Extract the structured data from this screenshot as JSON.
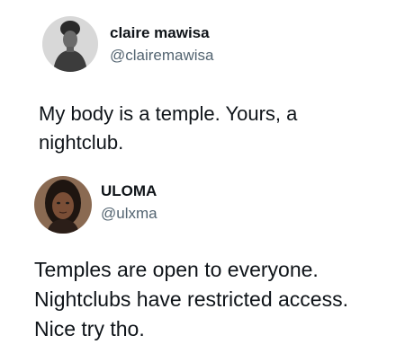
{
  "tweets": [
    {
      "display_name": "claire mawisa",
      "handle": "@clairemawisa",
      "body_lines": [
        "My body is a temple. Yours, a",
        "nightclub."
      ]
    },
    {
      "display_name": "ULOMA",
      "handle": "@ulxma",
      "body_lines": [
        "Temples are open to everyone.",
        "Nightclubs have restricted access.",
        "Nice try tho."
      ]
    }
  ],
  "colors": {
    "text": "#0f1419",
    "handle": "#536471",
    "background": "#ffffff"
  }
}
